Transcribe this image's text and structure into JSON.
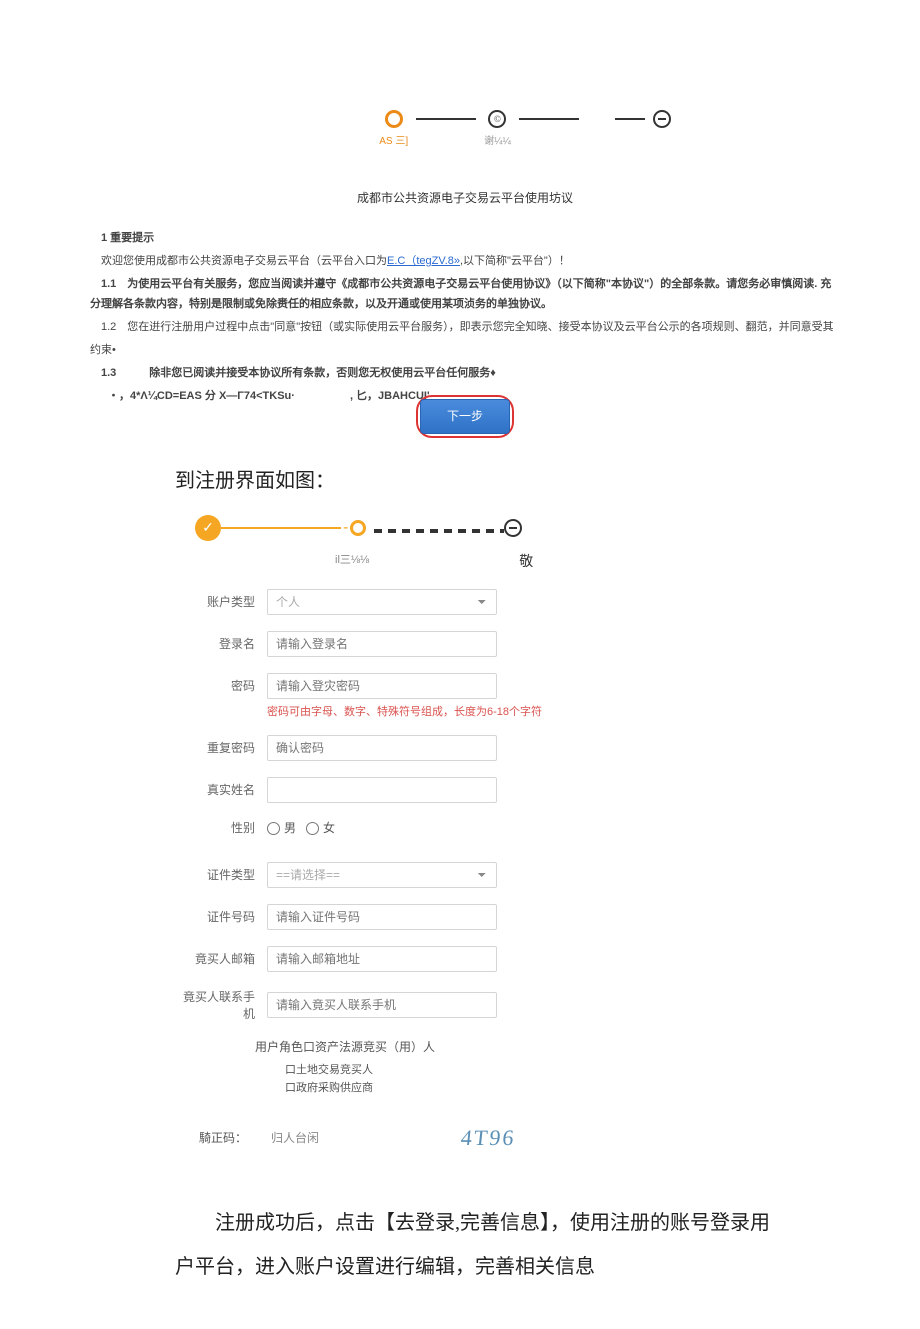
{
  "top_stepper": {
    "step1": "AS 三]",
    "step2": "谢¼¼"
  },
  "agreement": {
    "title": "成都市公共资源电子交易云平台使用坊议",
    "sec1": "1 重要提示",
    "p1a": "欢迎您使用成都市公共资源电子交易云平台（云平台入口为",
    "p1link": "E.C（tegZV.8»",
    "p1b": ",以下简称\"云平台\"）！",
    "p11": "1.1 为使用云平台有关服务，您应当阅读并遵守《成都市公共资源电子交易云平台使用协议》（以下简称\"本协议\"）的全部条款。请您务必审慎阅读. 充分理解各条款内容，特别是限制或免除赉任的相应条款，以及开通或使用某项浈务的单独协议。",
    "p12a": "1.2 您在逬行注册用户过程中点击\"同意\"按钮（或实际使用云平台服务），即表示您完全知晓、接受本协议及云平台公示的各项规则、翻范，并同意受其",
    "p12b": "约束•",
    "p13": "1.3   除非您已阅读并接受本协议所有条款，否则您无权使用云平台任何服务♦",
    "pfrag": "・，4*Λ¼CD=EAS 分 X—Γ74<TKSu·     , 匕，JBAHCUI'",
    "next": "下一步"
  },
  "section_heading": "到注册界面如图：",
  "step2_labels": {
    "mid": "il三⅛⅛",
    "end": "敬"
  },
  "form": {
    "account_type": {
      "label": "账户类型",
      "value": "个人"
    },
    "login_name": {
      "label": "登录名",
      "placeholder": "请输入登录名"
    },
    "password": {
      "label": "密码",
      "placeholder": "请输入登灾密码",
      "hint": "密码可由字⺟、数字、特殊符号组成，长度为6-18个字符"
    },
    "repassword": {
      "label": "重复密码",
      "placeholder": "确认密码"
    },
    "real_name": {
      "label": "真实姓名"
    },
    "gender": {
      "label": "性别",
      "male": "男",
      "female": "女"
    },
    "id_type": {
      "label": "证件类型",
      "value": "==请选择=="
    },
    "id_no": {
      "label": "证件号码",
      "placeholder": "请输入证件号码"
    },
    "email": {
      "label": "竟买人邮箱",
      "placeholder": "请输入邮箱地址"
    },
    "phone": {
      "label": "竟买人联系手机",
      "placeholder": "请输入竟买人联系手机"
    },
    "roles": {
      "head": "用户角色口资产法源竞买（用）人",
      "opt1": "口土地交易竞买人",
      "opt2": "口政府采购供应商"
    },
    "captcha": {
      "label": "騎正码：",
      "value": "归人台闲",
      "code": "4T96"
    }
  },
  "bottom": {
    "p1": "注册成功后，点击【去登录,完善信息】，使用注册的账号登录用",
    "p2": "户平台，进入账户设置进行编辑，完善相关信息"
  }
}
